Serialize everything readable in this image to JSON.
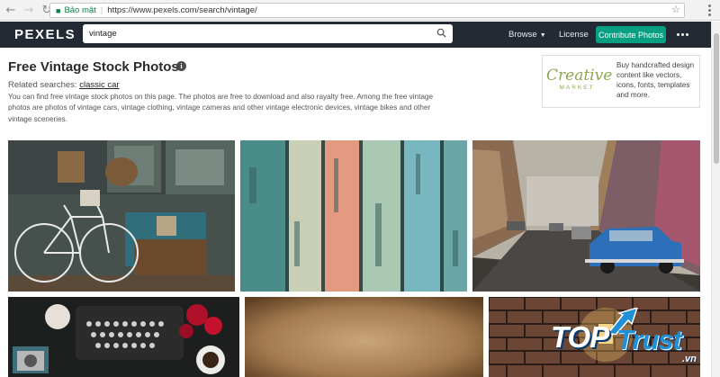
{
  "browser": {
    "secure_label": "Bảo mật",
    "url": "https://www.pexels.com/search/vintage/"
  },
  "header": {
    "logo": "PEXELS",
    "search_value": "vintage",
    "browse": "Browse",
    "license": "License",
    "contribute": "Contribute Photos"
  },
  "intro": {
    "title": "Free Vintage Stock Photos",
    "info_glyph": "i",
    "related_label": "Related searches:",
    "related_link": "classic car",
    "description": "You can find free vintage stock photos on this page. The photos are free to download and also rayalty free. Among the free vintage photos are photos of vintage cars, vintage clothing, vintage cameras and other vintage electronic devices, vintage bikes and other vintage sceneries."
  },
  "ad": {
    "logo_line1": "Creative",
    "logo_line2": "MARKET",
    "text": "Buy handcrafted design content like vectors, icons, fonts, templates and more."
  },
  "watermark": {
    "part1": "TOP",
    "part2": "Trust",
    "suffix": ".vn"
  },
  "colors": {
    "header_bg": "#232a34",
    "contribute_bg": "#05a081",
    "creative_green": "#8ba753"
  }
}
